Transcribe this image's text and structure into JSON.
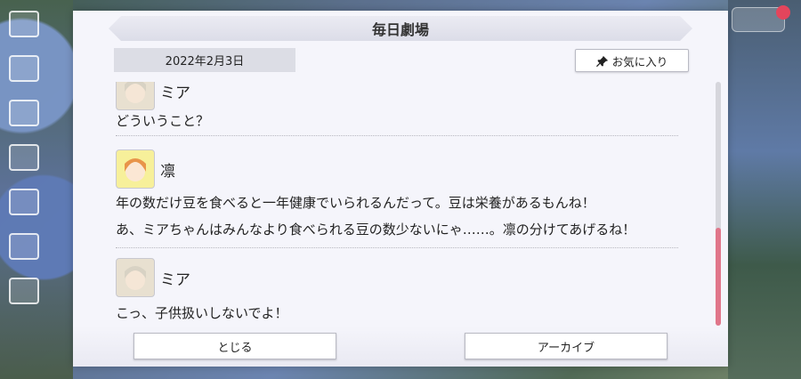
{
  "dialog": {
    "title": "毎日劇場",
    "date": "2022年2月3日",
    "favorite_label": "お気に入り",
    "close_label": "とじる",
    "archive_label": "アーカイブ"
  },
  "entries": [
    {
      "speaker": "ミア",
      "lines": [
        "どういうこと？"
      ]
    },
    {
      "speaker": "凛",
      "lines": [
        "年の数だけ豆を食べると一年健康でいられるんだって。豆は栄養があるもんね！",
        "あ、ミアちゃんはみんなより食べられる豆の数少ないにゃ……。凛の分けてあげるね！"
      ]
    },
    {
      "speaker": "ミア",
      "lines": [
        "こっ、子供扱いしないでよ！"
      ]
    }
  ],
  "scroll": {
    "position_fraction": 0.6
  },
  "colors": {
    "scroll_thumb": "#e0768a",
    "accent_red": "#e3455c"
  }
}
